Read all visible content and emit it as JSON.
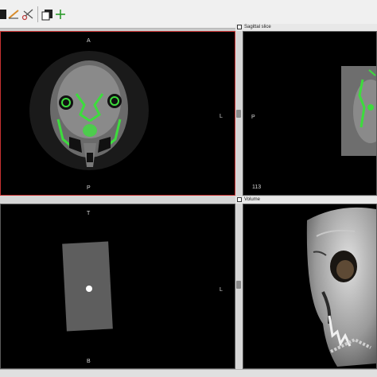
{
  "toolbar": {
    "icons": [
      "square-icon",
      "measure-pen-icon",
      "scissors-icon",
      "layers-icon",
      "plus-icon"
    ]
  },
  "views": {
    "axial": {
      "labels": {
        "top": "A",
        "bottom": "P",
        "right": "L"
      }
    },
    "sagittal": {
      "title": "Sagittal slice",
      "labels": {
        "left": "P",
        "slice_number": "113"
      }
    },
    "coronal": {
      "labels": {
        "top": "T",
        "bottom": "B",
        "right": "L"
      }
    },
    "volume": {
      "title": "Volume"
    }
  },
  "colors": {
    "segmentation": "#3ddc3d",
    "active_view_border": "#c83232",
    "viewport_background": "#000000"
  }
}
